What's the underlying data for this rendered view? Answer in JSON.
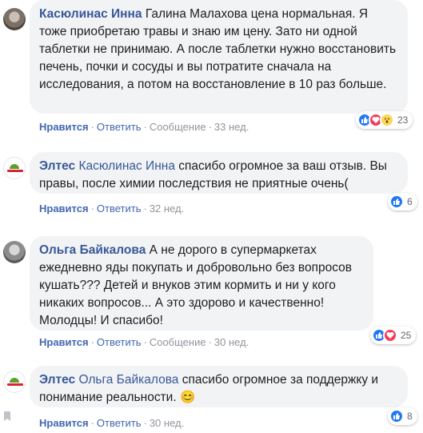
{
  "comments": [
    {
      "author": "Касюлинас Инна",
      "text": "Галина Малахова цена нормальная. Я тоже приобретаю травы и знаю им цену. Зато ни одной таблетки не принимаю. А после таблетки нужно восстановить печень, почки и сосуды и вы потратите сначала на исследования, а потом на восстановление в 10 раз больше.",
      "actions": {
        "like": "Нравится",
        "reply": "Ответить",
        "message": "Сообщение",
        "time": "33 нед."
      },
      "reactions": {
        "icons": [
          "like-icon",
          "love-icon",
          "wow-icon"
        ],
        "count": "23"
      }
    },
    {
      "author": "Элтес",
      "mention": "Касюлинас Инна",
      "text": "спасибо огромное за ваш отзыв. Вы правы, после химии последствия не приятные очень(",
      "actions": {
        "like": "Нравится",
        "reply": "Ответить",
        "time": "32 нед."
      },
      "reactions": {
        "icons": [
          "like-icon"
        ],
        "count": "6"
      }
    },
    {
      "author": "Ольга Байкалова",
      "text": "А не дорого в супермаркетах ежедневно яды покупать и добровольно без вопросов кушать??? Детей и внуков этим кормить и ни у кого никаких вопросов... А это здорово и качественно! Молодцы! И спасибо!",
      "actions": {
        "like": "Нравится",
        "reply": "Ответить",
        "message": "Сообщение",
        "time": "30 нед."
      },
      "reactions": {
        "icons": [
          "like-icon",
          "love-icon"
        ],
        "count": "25"
      }
    },
    {
      "author": "Элтес",
      "mention": "Ольга Байкалова",
      "text": "спасибо огромное за поддержку и понимание реальности.",
      "emoji": "😊",
      "actions": {
        "like": "Нравится",
        "reply": "Ответить",
        "time": "30 нед."
      },
      "reactions": {
        "icons": [
          "like-icon"
        ],
        "count": "8"
      }
    }
  ],
  "colors": {
    "link": "#385898",
    "action": "#4267b2",
    "muted": "#90949c",
    "bubble": "#f2f3f5"
  }
}
